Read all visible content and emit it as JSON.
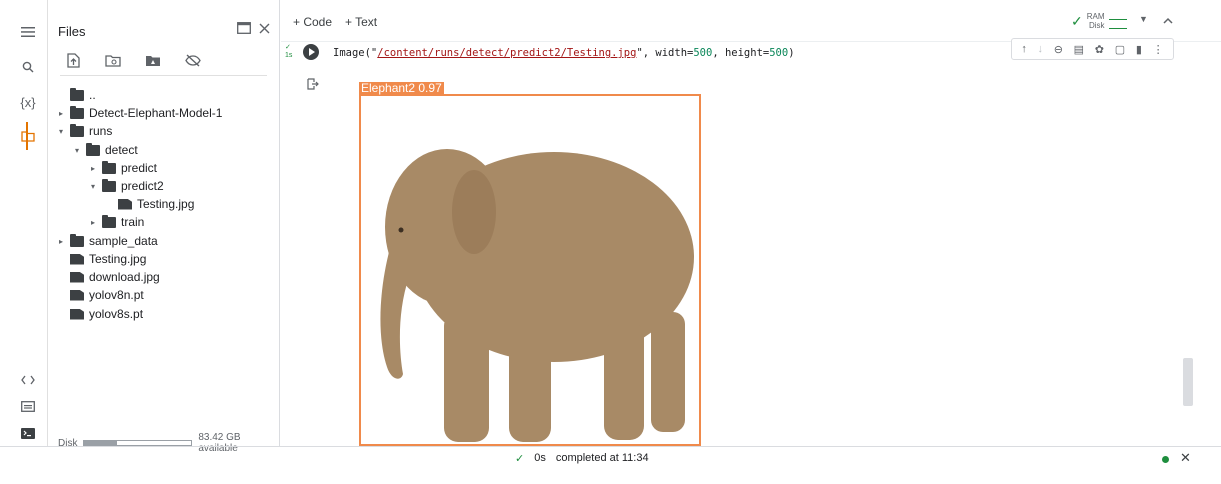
{
  "rail": {
    "icons": [
      "menu-icon",
      "search-icon",
      "variables-icon",
      "folder-icon",
      "code-snippets-icon",
      "command-palette-icon",
      "terminal-icon"
    ],
    "variables_glyph": "{x}"
  },
  "files_panel": {
    "title": "Files",
    "toolbar": [
      "upload-icon",
      "refresh-icon",
      "drive-icon",
      "hide-icon"
    ],
    "tree": [
      {
        "label": "..",
        "type": "folder-up",
        "depth": 0,
        "arrow": ""
      },
      {
        "label": "Detect-Elephant-Model-1",
        "type": "folder",
        "depth": 0,
        "arrow": "▸"
      },
      {
        "label": "runs",
        "type": "folder",
        "depth": 0,
        "arrow": "▾"
      },
      {
        "label": "detect",
        "type": "folder",
        "depth": 1,
        "arrow": "▾"
      },
      {
        "label": "predict",
        "type": "folder",
        "depth": 2,
        "arrow": "▸"
      },
      {
        "label": "predict2",
        "type": "folder",
        "depth": 2,
        "arrow": "▾"
      },
      {
        "label": "Testing.jpg",
        "type": "file",
        "depth": 3,
        "arrow": ""
      },
      {
        "label": "train",
        "type": "folder",
        "depth": 2,
        "arrow": "▸"
      },
      {
        "label": "sample_data",
        "type": "folder",
        "depth": 0,
        "arrow": "▸"
      },
      {
        "label": "Testing.jpg",
        "type": "file",
        "depth": 0,
        "arrow": ""
      },
      {
        "label": "download.jpg",
        "type": "file",
        "depth": 0,
        "arrow": ""
      },
      {
        "label": "yolov8n.pt",
        "type": "file",
        "depth": 0,
        "arrow": ""
      },
      {
        "label": "yolov8s.pt",
        "type": "file",
        "depth": 0,
        "arrow": ""
      }
    ],
    "disk_label": "Disk",
    "disk_used_fraction": 0.3,
    "disk_available": "83.42 GB available"
  },
  "topbar": {
    "add_code": "+ Code",
    "add_text": "+ Text",
    "ram_label": "RAM",
    "disk_label": "Disk"
  },
  "cell": {
    "status": "✓\n1s",
    "code_prefix": "Image(\"",
    "code_path": "/content/runs/detect/predict2/Testing.jpg",
    "code_mid1": "\", width=",
    "code_width": "500",
    "code_mid2": ", height=",
    "code_height": "500",
    "code_suffix": ")",
    "detection_label": "Elephant2  0.97"
  },
  "status_bar": {
    "check": "✓",
    "duration": "0s",
    "completed": "completed at 11:34"
  },
  "colors": {
    "accent_orange": "#e37400",
    "detection_box": "#f08a4b",
    "ok_green": "#1e8e3e"
  }
}
